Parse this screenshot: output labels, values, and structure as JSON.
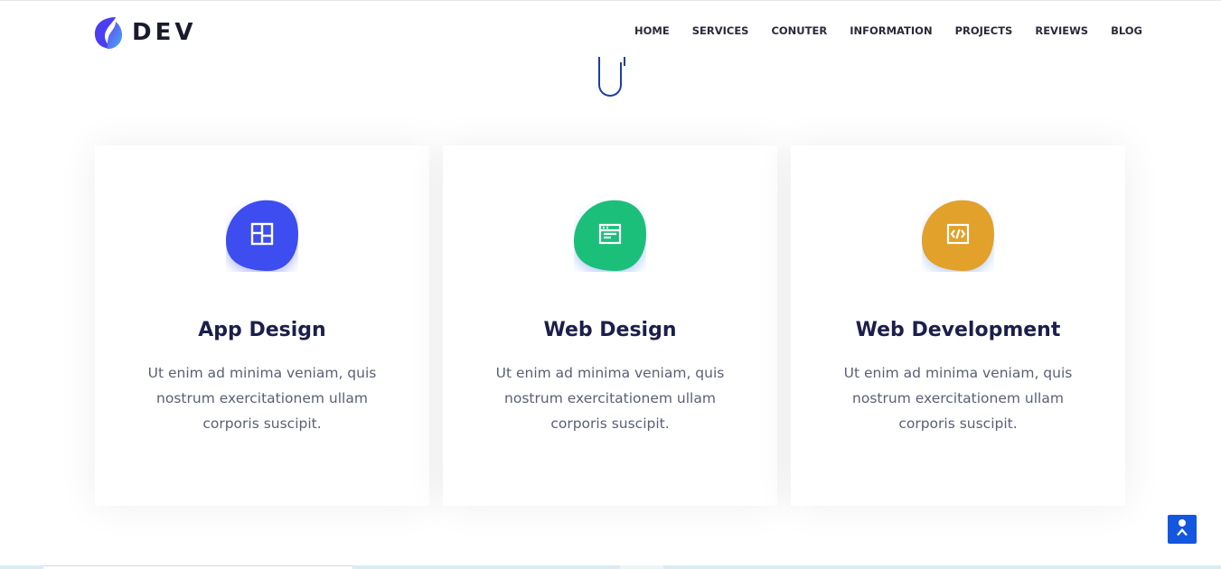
{
  "header": {
    "logo_text": "DEV",
    "nav": [
      {
        "label": "HOME"
      },
      {
        "label": "SERVICES"
      },
      {
        "label": "CONUTER"
      },
      {
        "label": "INFORMATION"
      },
      {
        "label": "PROJECTS"
      },
      {
        "label": "REVIEWS"
      },
      {
        "label": "BLOG"
      }
    ]
  },
  "services": [
    {
      "title": "App Design",
      "text": "Ut enim ad minima veniam, quis nostrum exercitationem ullam corporis suscipit.",
      "icon": "layout-icon",
      "color": "#3d4ef0"
    },
    {
      "title": "Web Design",
      "text": "Ut enim ad minima veniam, quis nostrum exercitationem ullam corporis suscipit.",
      "icon": "browser-window-icon",
      "color": "#1fbf7a"
    },
    {
      "title": "Web Development",
      "text": "Ut enim ad minima veniam, quis nostrum exercitationem ullam corporis suscipit.",
      "icon": "code-file-icon",
      "color": "#e2a12a"
    }
  ],
  "colors": {
    "brand_blue": "#1356e0",
    "heading": "#1b1f4a",
    "body_text": "#5a5f75"
  }
}
